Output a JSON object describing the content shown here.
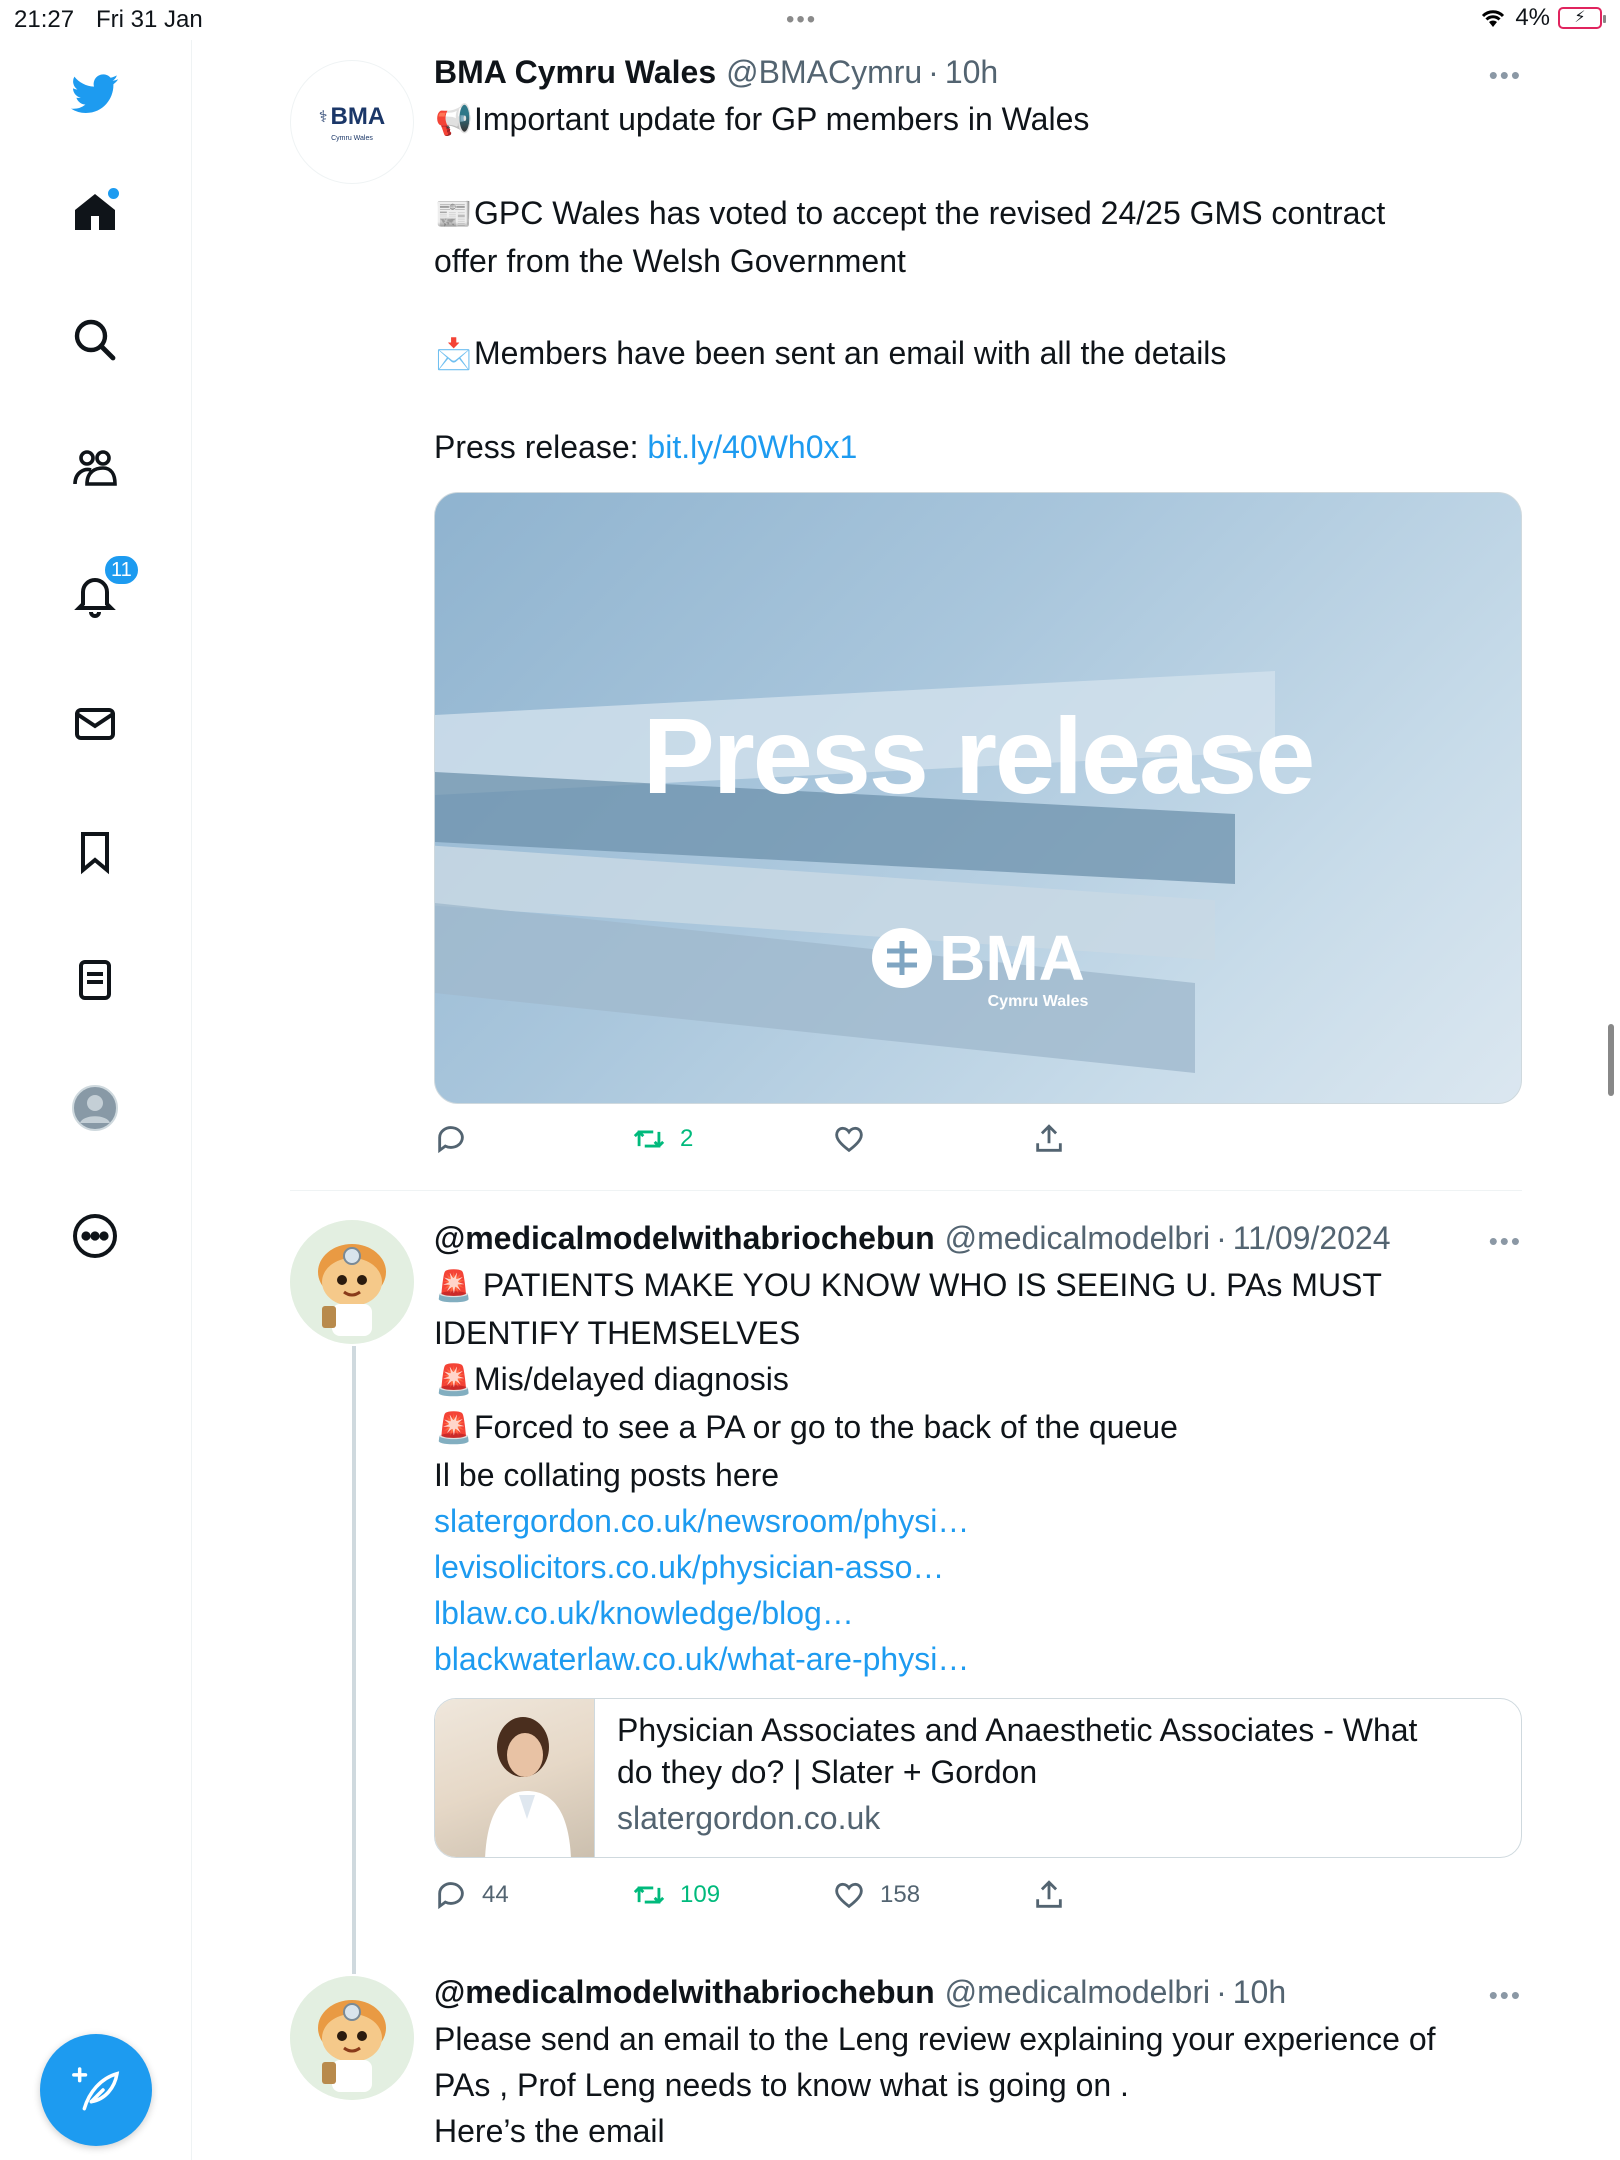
{
  "status": {
    "time": "21:27",
    "date": "Fri 31 Jan",
    "battery": "4%"
  },
  "sidebar": {
    "items": [
      {
        "name": "twitter-logo"
      },
      {
        "name": "home"
      },
      {
        "name": "explore"
      },
      {
        "name": "communities"
      },
      {
        "name": "notifications",
        "badge": "11"
      },
      {
        "name": "messages"
      },
      {
        "name": "bookmarks"
      },
      {
        "name": "lists"
      },
      {
        "name": "profile"
      },
      {
        "name": "more"
      }
    ],
    "compose_label": "+"
  },
  "colors": {
    "accent": "#1d9bf0",
    "retweet": "#00ba7c",
    "secondary": "#536471"
  },
  "tweets": [
    {
      "name": "BMA Cymru Wales",
      "handle": "@BMACymru",
      "time": "10h",
      "avatar_text": "BMA",
      "avatar_sub": "Cymru Wales",
      "lines": [
        {
          "emoji": "📢",
          "text": "Important update for GP members in Wales"
        },
        {
          "text": ""
        },
        {
          "emoji": "📰",
          "text": "GPC Wales has voted to accept the revised 24/25 GMS contract"
        },
        {
          "text": "offer from the Welsh Government"
        },
        {
          "text": ""
        },
        {
          "emoji": "📩",
          "text": "Members have been sent an email with all the details"
        },
        {
          "text": ""
        },
        {
          "text": "Press release: ",
          "link": "bit.ly/40Wh0x1"
        }
      ],
      "media": {
        "headline": "Press release",
        "logo": "BMA",
        "logo_sub": "Cymru Wales"
      },
      "actions": {
        "replies": "",
        "retweets": "2",
        "likes": ""
      }
    },
    {
      "name": "@medicalmodelwithabriochebun",
      "handle": "@medicalmodelbri",
      "time": "11/09/2024",
      "lines": [
        {
          "emoji": "🚨",
          "text": " PATIENTS MAKE  YOU KNOW WHO IS SEEING U. PAs MUST"
        },
        {
          "text": "IDENTIFY THEMSELVES"
        },
        {
          "emoji": "🚨",
          "text": "Mis/delayed diagnosis"
        },
        {
          "emoji": "🚨",
          "text": "Forced to see a PA or go to the back of the queue"
        },
        {
          "text": "Il be collating posts here"
        },
        {
          "link": "slatergordon.co.uk/newsroom/physi…"
        },
        {
          "link": "levisolicitors.co.uk/physician-asso…"
        },
        {
          "link": "lblaw.co.uk/knowledge/blog…"
        },
        {
          "link": "blackwaterlaw.co.uk/what-are-physi…"
        }
      ],
      "card": {
        "title_line1": "Physician Associates and Anaesthetic Associates - What",
        "title_line2": "do they do? | Slater + Gordon",
        "domain": "slatergordon.co.uk"
      },
      "actions": {
        "replies": "44",
        "retweets": "109",
        "likes": "158"
      }
    },
    {
      "name": "@medicalmodelwithabriochebun",
      "handle": "@medicalmodelbri",
      "time": "10h",
      "lines": [
        {
          "text": "Please send an email to the Leng review explaining your experience of"
        },
        {
          "text": "PAs , Prof Leng needs to know what is going on ."
        },
        {
          "text": "Here’s the email"
        }
      ]
    }
  ]
}
